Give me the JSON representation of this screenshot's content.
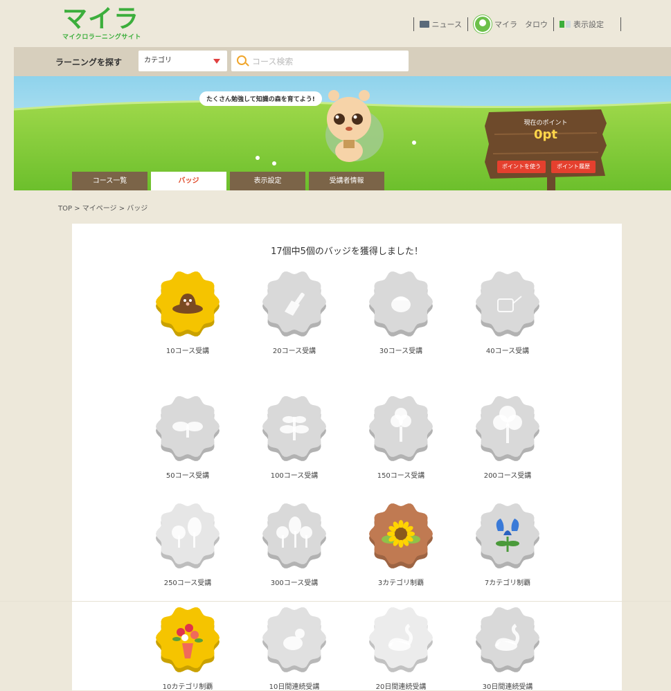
{
  "header": {
    "logo_mark": "マイラ",
    "logo_sub": "マイクロラーニングサイト",
    "nav": {
      "news": "ニュース",
      "user": "マイラ　タロウ",
      "display_settings": "表示設定"
    }
  },
  "search": {
    "label": "ラーニングを探す",
    "category_value": "カテゴリ",
    "placeholder": "コース検索"
  },
  "hero": {
    "speech": "たくさん勉強して知識の森を育てよう!",
    "points_label": "現在のポイント",
    "points_value": "0pt",
    "use_points": "ポイントを使う",
    "points_history": "ポイント履歴"
  },
  "tabs": [
    {
      "label": "コース一覧",
      "active": false
    },
    {
      "label": "バッジ",
      "active": true
    },
    {
      "label": "表示設定",
      "active": false
    },
    {
      "label": "受講者情報",
      "active": false
    }
  ],
  "breadcrumb": "TOP > マイページ > バッジ",
  "badges": {
    "summary": "17個中5個のバッジを獲得しました！",
    "items": [
      {
        "label": "10コース受講",
        "earned": true,
        "icon": "mole-icon",
        "color": "#f5c400"
      },
      {
        "label": "20コース受講",
        "earned": false,
        "icon": "trowel-icon",
        "color": "#d9d9d9"
      },
      {
        "label": "30コース受講",
        "earned": false,
        "icon": "seed-icon",
        "color": "#d9d9d9"
      },
      {
        "label": "40コース受講",
        "earned": false,
        "icon": "watering-can-icon",
        "color": "#d9d9d9"
      },
      {
        "label": "50コース受講",
        "earned": false,
        "icon": "sprout-icon",
        "color": "#d9d9d9"
      },
      {
        "label": "100コース受講",
        "earned": false,
        "icon": "seedling-icon",
        "color": "#d9d9d9"
      },
      {
        "label": "150コース受講",
        "earned": false,
        "icon": "sapling-icon",
        "color": "#d9d9d9"
      },
      {
        "label": "200コース受講",
        "earned": false,
        "icon": "tree-icon",
        "color": "#d9d9d9"
      },
      {
        "label": "250コース受講",
        "earned": false,
        "icon": "trees-icon",
        "color": "#e6e6e6"
      },
      {
        "label": "300コース受講",
        "earned": false,
        "icon": "forest-icon",
        "color": "#d9d9d9"
      },
      {
        "label": "3カテゴリ制覇",
        "earned": true,
        "icon": "sunflower-icon",
        "color": "#c07a52"
      },
      {
        "label": "7カテゴリ制覇",
        "earned": true,
        "icon": "blue-flower-icon",
        "color": "#d8d8d8"
      },
      {
        "label": "10カテゴリ制覇",
        "earned": true,
        "icon": "bouquet-icon",
        "color": "#f5c400"
      },
      {
        "label": "10日間連続受講",
        "earned": false,
        "icon": "duckling-icon",
        "color": "#e0e0e0"
      },
      {
        "label": "20日間連続受講",
        "earned": false,
        "icon": "swan-icon",
        "color": "#ececec"
      },
      {
        "label": "30日間連続受講",
        "earned": false,
        "icon": "swan-icon",
        "color": "#d9d9d9"
      }
    ]
  },
  "colors": {
    "brand_green": "#3cae3c",
    "brand_orange": "#f0a52a",
    "accent_red": "#e04a2a",
    "tab_brown": "#7b6448"
  }
}
